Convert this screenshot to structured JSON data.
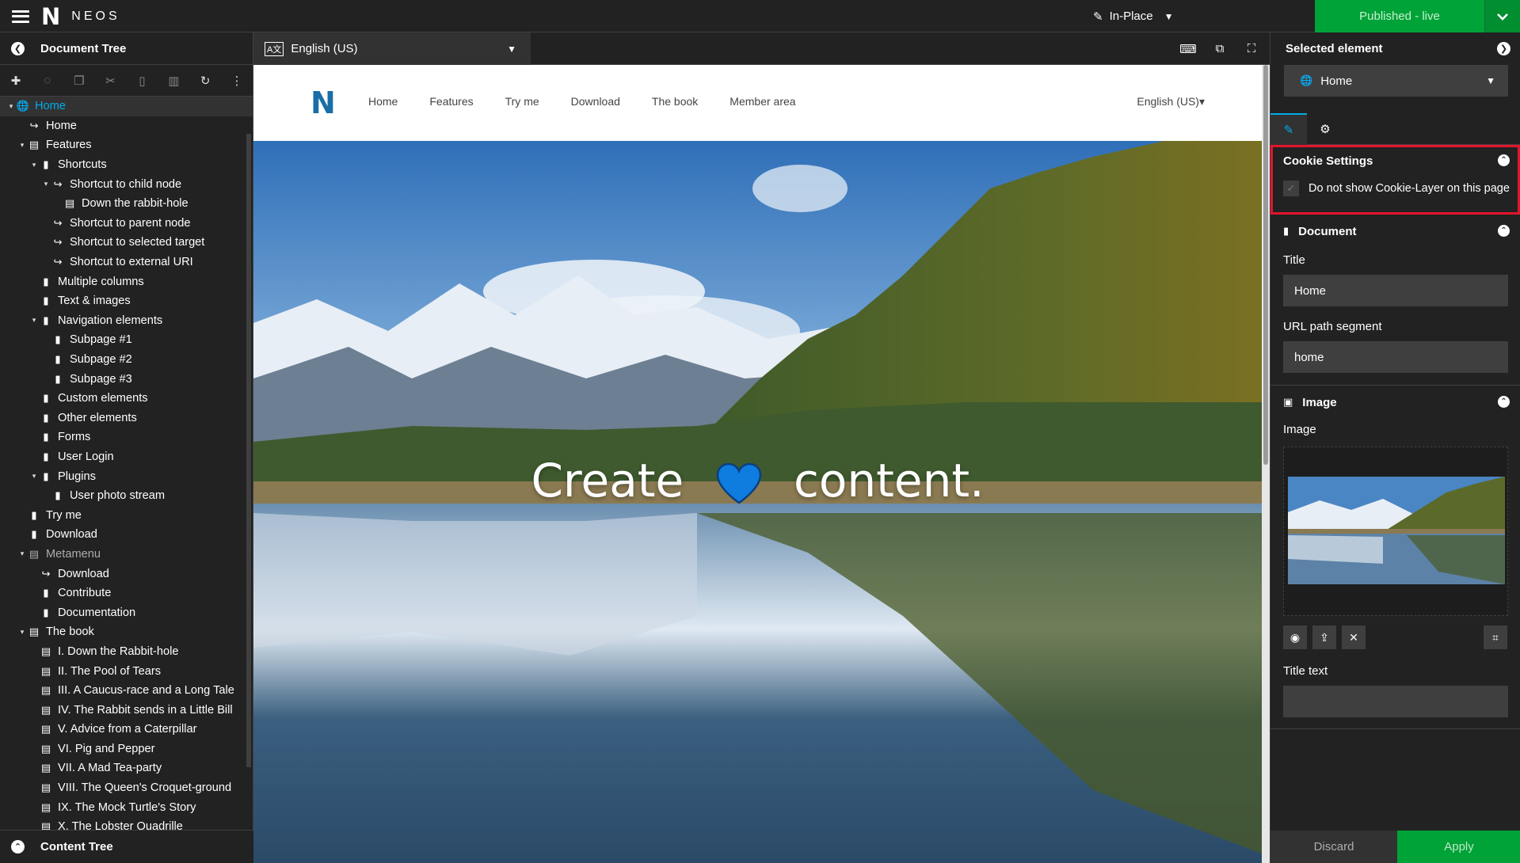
{
  "topbar": {
    "menu_icon": "hamburger-icon",
    "logo_mark": "N",
    "logo_text": "NEOS",
    "edit_mode_label": "In-Place",
    "publish_label": "Published - live"
  },
  "left": {
    "title": "Document Tree",
    "content_tree_title": "Content Tree",
    "toolbar_icons": [
      "add-icon",
      "hide-icon",
      "copy-icon",
      "cut-icon",
      "paste-icon",
      "delete-icon",
      "refresh-icon",
      "more-icon"
    ],
    "nodes": [
      {
        "label": "Home",
        "depth": 0,
        "toggle": "▾",
        "icon": "🌐",
        "state": "active"
      },
      {
        "label": "Home",
        "depth": 1,
        "toggle": "",
        "icon": "↪",
        "state": ""
      },
      {
        "label": "Features",
        "depth": 1,
        "toggle": "▾",
        "icon": "▤",
        "state": ""
      },
      {
        "label": "Shortcuts",
        "depth": 2,
        "toggle": "▾",
        "icon": "▮",
        "state": ""
      },
      {
        "label": "Shortcut to child node",
        "depth": 3,
        "toggle": "▾",
        "icon": "↪",
        "state": ""
      },
      {
        "label": "Down the rabbit-hole",
        "depth": 4,
        "toggle": "",
        "icon": "▤",
        "state": ""
      },
      {
        "label": "Shortcut to parent node",
        "depth": 3,
        "toggle": "",
        "icon": "↪",
        "state": ""
      },
      {
        "label": "Shortcut to selected target",
        "depth": 3,
        "toggle": "",
        "icon": "↪",
        "state": ""
      },
      {
        "label": "Shortcut to external URI",
        "depth": 3,
        "toggle": "",
        "icon": "↪",
        "state": ""
      },
      {
        "label": "Multiple columns",
        "depth": 2,
        "toggle": "",
        "icon": "▮",
        "state": ""
      },
      {
        "label": "Text & images",
        "depth": 2,
        "toggle": "",
        "icon": "▮",
        "state": ""
      },
      {
        "label": "Navigation elements",
        "depth": 2,
        "toggle": "▾",
        "icon": "▮",
        "state": ""
      },
      {
        "label": "Subpage #1",
        "depth": 3,
        "toggle": "",
        "icon": "▮",
        "state": ""
      },
      {
        "label": "Subpage #2",
        "depth": 3,
        "toggle": "",
        "icon": "▮",
        "state": ""
      },
      {
        "label": "Subpage #3",
        "depth": 3,
        "toggle": "",
        "icon": "▮",
        "state": ""
      },
      {
        "label": "Custom elements",
        "depth": 2,
        "toggle": "",
        "icon": "▮",
        "state": ""
      },
      {
        "label": "Other elements",
        "depth": 2,
        "toggle": "",
        "icon": "▮",
        "state": ""
      },
      {
        "label": "Forms",
        "depth": 2,
        "toggle": "",
        "icon": "▮",
        "state": ""
      },
      {
        "label": "User Login",
        "depth": 2,
        "toggle": "",
        "icon": "▮",
        "state": ""
      },
      {
        "label": "Plugins",
        "depth": 2,
        "toggle": "▾",
        "icon": "▮",
        "state": ""
      },
      {
        "label": "User photo stream",
        "depth": 3,
        "toggle": "",
        "icon": "▮",
        "state": ""
      },
      {
        "label": "Try me",
        "depth": 1,
        "toggle": "",
        "icon": "▮",
        "state": ""
      },
      {
        "label": "Download",
        "depth": 1,
        "toggle": "",
        "icon": "▮",
        "state": ""
      },
      {
        "label": "Metamenu",
        "depth": 1,
        "toggle": "▾",
        "icon": "▤",
        "state": "dim"
      },
      {
        "label": "Download",
        "depth": 2,
        "toggle": "",
        "icon": "↪",
        "state": ""
      },
      {
        "label": "Contribute",
        "depth": 2,
        "toggle": "",
        "icon": "▮",
        "state": ""
      },
      {
        "label": "Documentation",
        "depth": 2,
        "toggle": "",
        "icon": "▮",
        "state": ""
      },
      {
        "label": "The book",
        "depth": 1,
        "toggle": "▾",
        "icon": "▤",
        "state": ""
      },
      {
        "label": "I. Down the Rabbit-hole",
        "depth": 2,
        "toggle": "",
        "icon": "▤",
        "state": ""
      },
      {
        "label": "II. The Pool of Tears",
        "depth": 2,
        "toggle": "",
        "icon": "▤",
        "state": ""
      },
      {
        "label": "III. A Caucus-race and a Long Tale",
        "depth": 2,
        "toggle": "",
        "icon": "▤",
        "state": ""
      },
      {
        "label": "IV. The Rabbit sends in a Little Bill",
        "depth": 2,
        "toggle": "",
        "icon": "▤",
        "state": ""
      },
      {
        "label": "V. Advice from a Caterpillar",
        "depth": 2,
        "toggle": "",
        "icon": "▤",
        "state": ""
      },
      {
        "label": "VI. Pig and Pepper",
        "depth": 2,
        "toggle": "",
        "icon": "▤",
        "state": ""
      },
      {
        "label": "VII. A Mad Tea-party",
        "depth": 2,
        "toggle": "",
        "icon": "▤",
        "state": ""
      },
      {
        "label": "VIII. The Queen's Croquet-ground",
        "depth": 2,
        "toggle": "",
        "icon": "▤",
        "state": ""
      },
      {
        "label": "IX. The Mock Turtle's Story",
        "depth": 2,
        "toggle": "",
        "icon": "▤",
        "state": ""
      },
      {
        "label": "X. The Lobster Quadrille",
        "depth": 2,
        "toggle": "",
        "icon": "▤",
        "state": ""
      }
    ]
  },
  "center": {
    "dimension_label": "English (US)",
    "site": {
      "logo_mark": "N",
      "nav": [
        "Home",
        "Features",
        "Try me",
        "Download",
        "The book",
        "Member area"
      ],
      "language": "English (US)▾",
      "hero_word_1": "Create",
      "hero_word_2": "content."
    }
  },
  "right": {
    "title": "Selected element",
    "node_selector": "Home",
    "cookie": {
      "title": "Cookie Settings",
      "checkbox_label": "Do not show Cookie-Layer on this page"
    },
    "document": {
      "title": "Document",
      "title_label": "Title",
      "title_value": "Home",
      "url_label": "URL path segment",
      "url_value": "home"
    },
    "image": {
      "title": "Image",
      "image_label": "Image",
      "title_text_label": "Title text",
      "title_text_value": ""
    },
    "discard_label": "Discard",
    "apply_label": "Apply"
  },
  "colors": {
    "accent": "#00adee",
    "publish_green": "#00a338",
    "highlight_red": "#e3152c",
    "panel_bg": "#222222"
  }
}
